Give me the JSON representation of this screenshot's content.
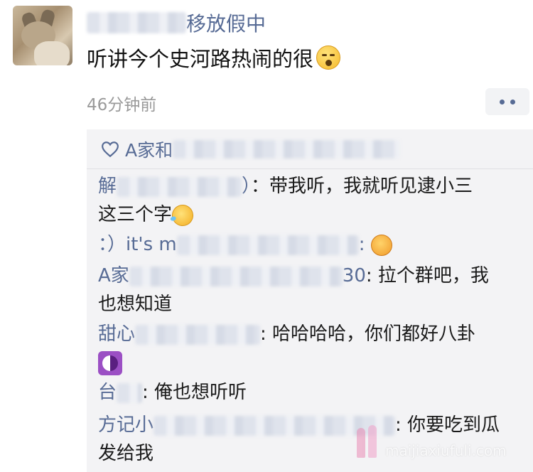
{
  "post": {
    "poster_name_visible": "移放假中",
    "text": "听讲今个史河路热闹的很",
    "time_ago": "46分钟前"
  },
  "likes": {
    "name_prefix": "A家和"
  },
  "comments": [
    {
      "name_prefix": "解",
      "name_suffix": "）",
      "text_line1": "：带我听，我就听见逮小三",
      "text_line2": "这三个字"
    },
    {
      "name_prefix": "：）it's m",
      "name_suffix": ":",
      "text_line1": ""
    },
    {
      "name_prefix": "A家",
      "name_suffix": "30",
      "text_line1": ": 拉个群吧，我",
      "text_line2": "也想知道"
    },
    {
      "name_prefix": "甜心",
      "name_suffix": "",
      "text_line1": ": 哈哈哈哈，你们都好八卦"
    },
    {
      "name_prefix": "台",
      "name_suffix": "",
      "text_line1": ": 俺也想听听"
    },
    {
      "name_prefix": "方记小",
      "name_suffix": "",
      "text_line1": ": 你要吃到瓜",
      "text_line2": "发给我"
    }
  ],
  "watermark": {
    "text": "maijiaxiufuli.com"
  },
  "colors": {
    "link_blue": "#576b95",
    "panel_bg": "#f3f3f5",
    "timestamp_gray": "#9a9a9a"
  }
}
